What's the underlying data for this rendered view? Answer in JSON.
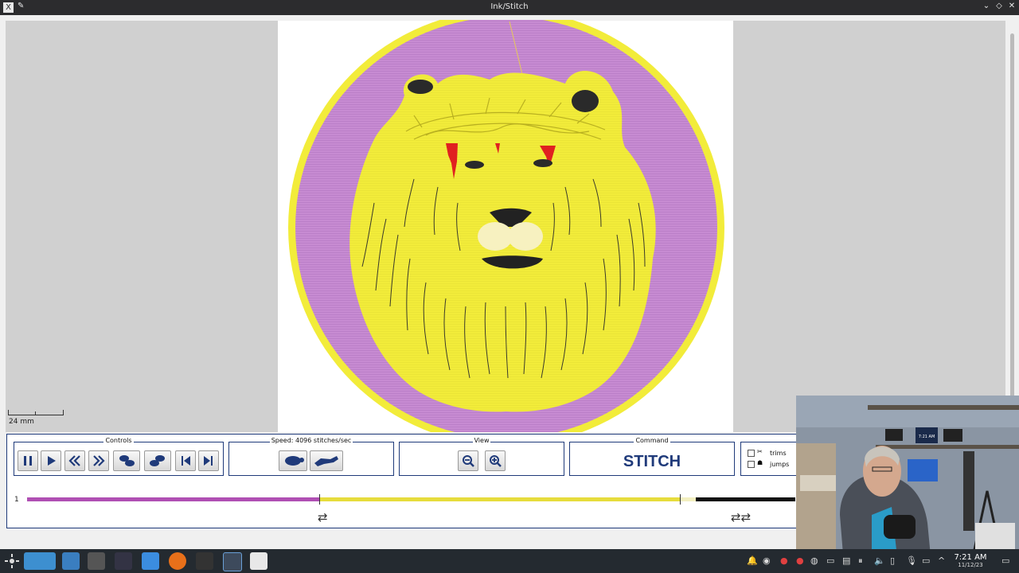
{
  "window": {
    "title": "Ink/Stitch",
    "app_icon": "X"
  },
  "canvas": {
    "scale_label": "24 mm"
  },
  "controls": {
    "label": "Controls",
    "buttons": [
      "pause-icon",
      "play-icon",
      "rewind-icon",
      "fast-forward-icon",
      "step-backward-icon",
      "step-forward-icon",
      "skip-to-start-icon",
      "skip-to-end-icon"
    ]
  },
  "speed": {
    "label": "Speed: 4096 stitches/sec"
  },
  "view": {
    "label": "View"
  },
  "command": {
    "label": "Command",
    "value": "STITCH"
  },
  "options": {
    "trims_label": "trims",
    "jumps_label": "jumps",
    "trims_checked": false,
    "jumps_checked": false
  },
  "timeline": {
    "track_number": "1",
    "segments": [
      {
        "color": "#b04fb3",
        "fraction": 0.38
      },
      {
        "color": "#e6dc3c",
        "fraction": 0.47
      },
      {
        "color": "#f2efc0",
        "fraction": 0.02
      },
      {
        "color": "#111111",
        "fraction": 0.13
      }
    ],
    "progress": 0.38
  },
  "colors": {
    "accent": "#1f3a7a",
    "purple_thread": "#b77ac7",
    "yellow_thread": "#f2ec3a",
    "red_thread": "#e02020"
  },
  "taskbar": {
    "clock_time": "7:21 AM",
    "clock_date": "11/12/23",
    "webcam_clock": "7:21 AM"
  }
}
